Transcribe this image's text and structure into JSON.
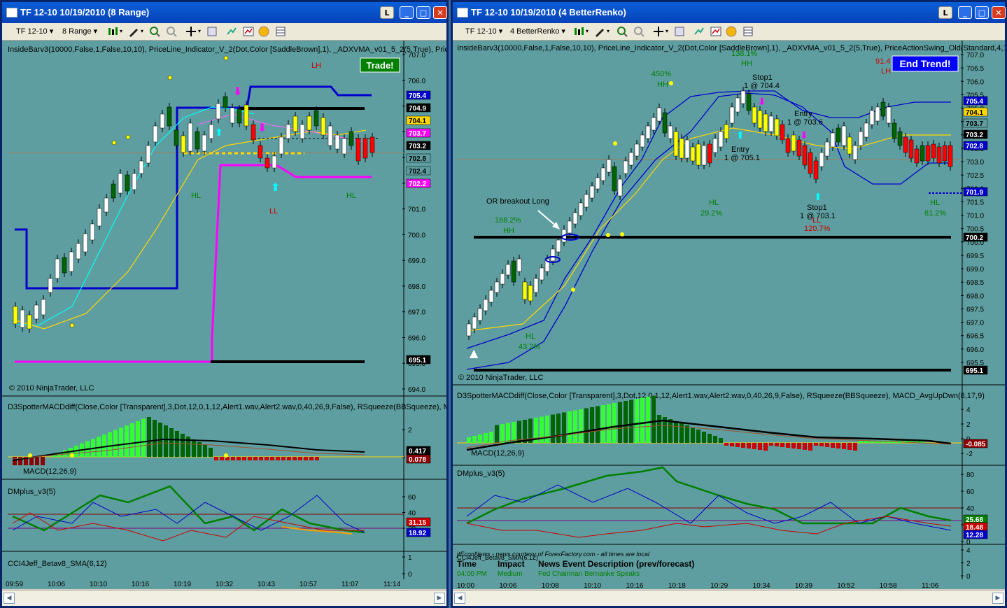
{
  "left": {
    "title": "TF 12-10  10/19/2010 (8 Range)",
    "instrument": "TF 12-10",
    "period": "8 Range",
    "indicator_line": "InsideBarv3(10000,False,1,False,10,10),  PriceLine_Indicator_V_2(Dot,Color [SaddleBrown],1),  _ADXVMA_v01_5_2(5,True),  Pric",
    "trade_banner": "Trade!",
    "copyright": "© 2010 NinjaTrader, LLC",
    "macd_line": "D3SpotterMACDdiff(Close,Color [Transparent],3,Dot,12,0,1,12,Alert1.wav,Alert2.wav,0,40,26,9,False), RSqueeze(BBSqueeze), M",
    "macd_label": "MACD(12,26,9)",
    "dm_label": "DMplus_v3(5)",
    "cci_label": "CCI4Jeff_Betav8_SMA(6,12)",
    "swing_labels": {
      "lh": "LH",
      "hl1": "HL",
      "ll": "LL",
      "hl2": "HL"
    },
    "price_axis": [
      "707.0",
      "706.0",
      "705.0",
      "704.0",
      "703.0",
      "702.0",
      "701.0",
      "700.0",
      "699.0",
      "698.0",
      "697.0",
      "696.0",
      "695.0",
      "694.0"
    ],
    "price_tags": [
      {
        "text": "705.4",
        "bg": "#0000cc",
        "fg": "#ffffff"
      },
      {
        "text": "704.9",
        "bg": "#000000",
        "fg": "#ffffff"
      },
      {
        "text": "704.1",
        "bg": "#ffd700",
        "fg": "#000000"
      },
      {
        "text": "703.7",
        "bg": "#ff00ff",
        "fg": "#ffffff"
      },
      {
        "text": "703.2",
        "bg": "#000000",
        "fg": "#ffffff"
      },
      {
        "text": "702.8",
        "bg": "#5f9ea0",
        "fg": "#000000"
      },
      {
        "text": "702.4",
        "bg": "#5f9ea0",
        "fg": "#000000"
      },
      {
        "text": "702.2",
        "bg": "#ff00ff",
        "fg": "#ffffff"
      },
      {
        "text": "695.1",
        "bg": "#000000",
        "fg": "#ffffff"
      }
    ],
    "macd_axis": [
      "2",
      "0"
    ],
    "macd_tags": [
      {
        "text": "0.417",
        "bg": "#000000",
        "fg": "#ffffff"
      },
      {
        "text": "0.078",
        "bg": "#8b0000",
        "fg": "#ffffff"
      }
    ],
    "dm_axis": [
      "60",
      "40",
      "20"
    ],
    "dm_tags": [
      {
        "text": "31.15",
        "bg": "#cc0000",
        "fg": "#ffffff"
      },
      {
        "text": "18.92",
        "bg": "#0000cc",
        "fg": "#ffffff"
      }
    ],
    "cci_axis": [
      "1",
      "0"
    ],
    "time_axis": [
      "09:59",
      "10:06",
      "10:10",
      "10:16",
      "10:19",
      "10:32",
      "10:43",
      "10:57",
      "11:07",
      "11:14"
    ]
  },
  "right": {
    "title": "TF 12-10  10/19/2010 (4 BetterRenko)",
    "instrument": "TF 12-10",
    "period": "4 BetterRenko",
    "indicator_line": "InsideBarv3(10000,False,1,False,10,10),  PriceLine_Indicator_V_2(Dot,Color [SaddleBrown],1),  _ADXVMA_v01_5_2(5,True),  PriceActionSwing_Old(Standard,4,1",
    "end_banner": "End Trend!",
    "copyright": "© 2010 NinjaTrader, LLC",
    "annotations": {
      "or_breakout": "OR breakout Long",
      "p168": "168.2%",
      "hh1": "HH",
      "p450": "450%",
      "hh2": "HH",
      "p138": "138.1%",
      "hh3": "HH",
      "stop1a": "Stop1",
      "stop1a_fill": "1 @ 704.4",
      "entry1": "Entry",
      "entry1_fill": "1 @ 705.1",
      "entry2": "Entry",
      "entry2_fill": "1 @ 703.6",
      "hl1": "HL",
      "p29": "29.2%",
      "stop1b": "Stop1",
      "stop1b_fill": "1 @ 703.1",
      "ll": "LL",
      "p120": "120.7%",
      "hl2": "HL",
      "p81": "81.2%",
      "p91": "91.4",
      "lh": "LH",
      "hl3": "HL",
      "p43": "43.2%"
    },
    "price_axis": [
      "707.0",
      "706.5",
      "706.0",
      "705.5",
      "705.0",
      "704.5",
      "704.0",
      "703.5",
      "703.0",
      "702.5",
      "702.0",
      "701.5",
      "701.0",
      "700.5",
      "700.0",
      "699.5",
      "699.0",
      "698.5",
      "698.0",
      "697.5",
      "697.0",
      "696.5",
      "696.0",
      "695.5"
    ],
    "price_tags": [
      {
        "text": "705.4",
        "bg": "#0000cc",
        "fg": "#ffffff"
      },
      {
        "text": "704.1",
        "bg": "#ffd700",
        "fg": "#000000"
      },
      {
        "text": "703.7",
        "bg": "#5f9ea0",
        "fg": "#000000"
      },
      {
        "text": "703.2",
        "bg": "#000000",
        "fg": "#ffffff"
      },
      {
        "text": "702.8",
        "bg": "#0000cc",
        "fg": "#ffffff"
      },
      {
        "text": "701.9",
        "bg": "#0000cc",
        "fg": "#ffffff"
      },
      {
        "text": "700.2",
        "bg": "#000000",
        "fg": "#ffffff"
      },
      {
        "text": "695.1",
        "bg": "#000000",
        "fg": "#ffffff"
      }
    ],
    "macd_line": "D3SpotterMACDdiff(Close,Color [Transparent],3,Dot,12,0,1,12,Alert1.wav,Alert2.wav,0,40,26,9,False), RSqueeze(BBSqueeze), MACD_AvgUpDwn(8,17,9)",
    "macd_label": "MACD(12,26,9)",
    "macd_axis": [
      "4",
      "2",
      "0",
      "-2"
    ],
    "macd_tags": [
      {
        "text": "-0.085",
        "bg": "#8b0000",
        "fg": "#ffffff"
      }
    ],
    "dm_label": "DMplus_v3(5)",
    "dm_axis": [
      "80",
      "60",
      "40",
      "20",
      "0"
    ],
    "dm_tags": [
      {
        "text": "25.68",
        "bg": "#008000",
        "fg": "#ffffff"
      },
      {
        "text": "18.48",
        "bg": "#cc0000",
        "fg": "#ffffff"
      },
      {
        "text": "12.28",
        "bg": "#0000cc",
        "fg": "#ffffff"
      }
    ],
    "news_header": "jtEconNews - news courtesy of ForexFactory.com - all times are local",
    "news_cols": {
      "time": "Time",
      "impact": "Impact",
      "desc": "News Event Description (prev/forecast)"
    },
    "news_row": {
      "time": "04:00 PM",
      "impact": "Medium",
      "desc": "Fed Chairman Bernanke Speaks"
    },
    "cci_label": "CCI4Jeff_Betav8_SMA(6,12)",
    "cci_axis": [
      "4",
      "2",
      "0"
    ],
    "time_axis": [
      "10:00",
      "10:06",
      "10:08",
      "10:10",
      "10:16",
      "10:18",
      "10:29",
      "10:34",
      "10:39",
      "10:52",
      "10:58",
      "11:06"
    ]
  },
  "buttons": {
    "l": "L",
    "min": "_",
    "max": "□",
    "close": "✕"
  }
}
